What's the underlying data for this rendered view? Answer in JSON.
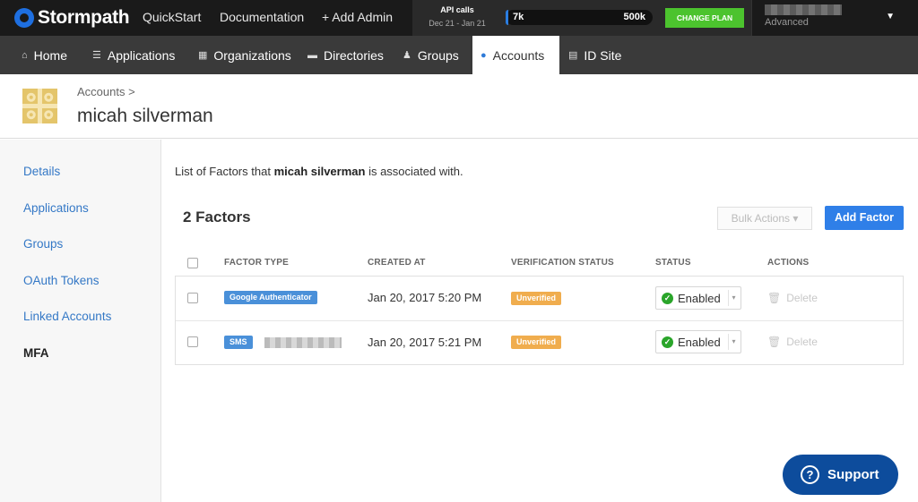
{
  "topbar": {
    "brand": "Stormpath",
    "links": [
      "QuickStart",
      "Documentation",
      "+ Add Admin"
    ],
    "api": {
      "title": "API calls",
      "dates": "Dec 21 - Jan 21",
      "used": "7k",
      "limit": "500k",
      "usage_fraction": 0.014
    },
    "change_plan": "CHANGE PLAN",
    "plan": "Advanced"
  },
  "nav": {
    "items": [
      {
        "label": "Home",
        "icon": "home-icon"
      },
      {
        "label": "Applications",
        "icon": "layers-icon"
      },
      {
        "label": "Organizations",
        "icon": "grid-icon"
      },
      {
        "label": "Directories",
        "icon": "folder-icon"
      },
      {
        "label": "Groups",
        "icon": "users-icon"
      },
      {
        "label": "Accounts",
        "icon": "user-icon",
        "active": true
      },
      {
        "label": "ID Site",
        "icon": "id-card-icon"
      }
    ]
  },
  "header": {
    "breadcrumb": "Accounts >",
    "title": "micah silverman"
  },
  "sidebar": {
    "items": [
      {
        "label": "Details"
      },
      {
        "label": "Applications"
      },
      {
        "label": "Groups"
      },
      {
        "label": "OAuth Tokens"
      },
      {
        "label": "Linked Accounts"
      },
      {
        "label": "MFA",
        "active": true
      }
    ]
  },
  "main": {
    "intro_prefix": "List of Factors that",
    "intro_name": "micah silverman",
    "intro_suffix": "is associated with.",
    "count": "2 Factors",
    "bulk_actions": "Bulk Actions ▾",
    "add_factor": "Add Factor",
    "columns": [
      "FACTOR TYPE",
      "CREATED AT",
      "VERIFICATION STATUS",
      "STATUS",
      "ACTIONS"
    ],
    "rows": [
      {
        "type": "Google Authenticator",
        "created": "Jan 20, 2017 5:20 PM",
        "verification": "Unverified",
        "status": "Enabled",
        "action": "Delete"
      },
      {
        "type": "SMS",
        "created": "Jan 20, 2017 5:21 PM",
        "verification": "Unverified",
        "status": "Enabled",
        "action": "Delete"
      }
    ]
  },
  "support": {
    "label": "Support"
  },
  "colors": {
    "accent": "#2f7fe8",
    "success": "#4cc32e",
    "warning": "#f0ad4e",
    "navbar": "#3a3a3a",
    "topbar": "#1a1a1a",
    "support": "#0d4c9c"
  }
}
